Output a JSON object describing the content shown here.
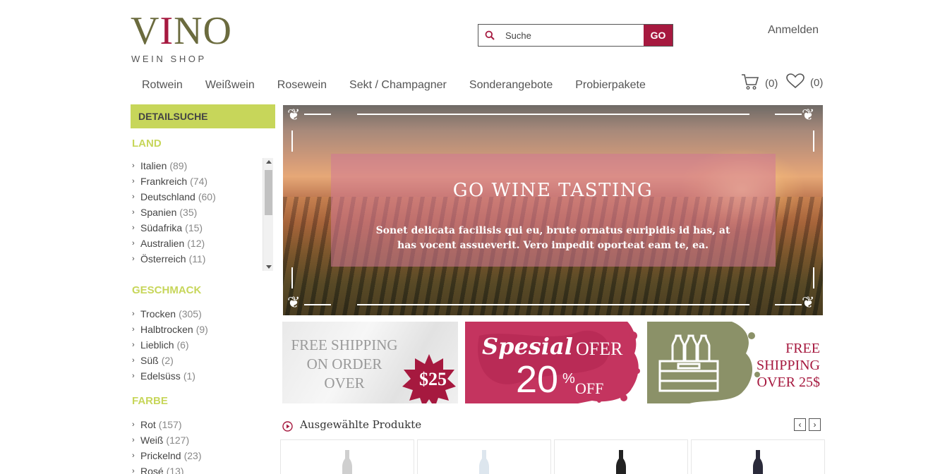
{
  "logo": {
    "main_pre": "V",
    "main_i": "I",
    "main_post": "NO",
    "sub": "WEIN SHOP"
  },
  "search": {
    "placeholder": "Suche",
    "button_label": "GO"
  },
  "header": {
    "login_label": "Anmelden",
    "cart_count": "(0)",
    "wishlist_count": "(0)"
  },
  "nav": {
    "items": [
      {
        "label": "Rotwein"
      },
      {
        "label": "Weißwein"
      },
      {
        "label": "Rosewein"
      },
      {
        "label": "Sekt / Champagner"
      },
      {
        "label": "Sonderangebote"
      },
      {
        "label": "Probierpakete"
      }
    ]
  },
  "sidebar": {
    "header": "DETAILSUCHE",
    "land": {
      "title": "LAND",
      "items": [
        {
          "label": "Italien",
          "count": "(89)"
        },
        {
          "label": "Frankreich",
          "count": "(74)"
        },
        {
          "label": "Deutschland",
          "count": "(60)"
        },
        {
          "label": "Spanien",
          "count": "(35)"
        },
        {
          "label": "Südafrika",
          "count": "(15)"
        },
        {
          "label": "Australien",
          "count": "(12)"
        },
        {
          "label": "Österreich",
          "count": "(11)"
        }
      ]
    },
    "geschmack": {
      "title": "GESCHMACK",
      "items": [
        {
          "label": "Trocken",
          "count": "(305)"
        },
        {
          "label": "Halbtrocken",
          "count": "(9)"
        },
        {
          "label": "Lieblich",
          "count": "(6)"
        },
        {
          "label": "Süß",
          "count": "(2)"
        },
        {
          "label": "Edelsüss",
          "count": "(1)"
        }
      ]
    },
    "farbe": {
      "title": "FARBE",
      "items": [
        {
          "label": "Rot",
          "count": "(157)"
        },
        {
          "label": "Weiß",
          "count": "(127)"
        },
        {
          "label": "Prickelnd",
          "count": "(23)"
        },
        {
          "label": "Rosé",
          "count": "(13)"
        }
      ]
    }
  },
  "hero": {
    "title": "GO WINE TASTING",
    "text": "Sonet delicata facilisis qui eu, brute ornatus euripidis id has, at has vocent assueverit. Vero impedit oporteat eam te, ea."
  },
  "promos": {
    "p1": {
      "line1": "FREE SHIPPING",
      "line2": "ON ORDER",
      "line3": "OVER",
      "price": "$25"
    },
    "p2": {
      "script": "Spesial",
      "ofer": "OFER",
      "percent": "20",
      "pct_sign": "%",
      "off": "OFF"
    },
    "p3": {
      "line1": "FREE",
      "line2": "SHIPPING",
      "line3": "OVER 25$"
    }
  },
  "featured": {
    "title": "Ausgewählte Produkte"
  },
  "colors": {
    "accent": "#a6193f",
    "green": "#c7d65a",
    "olive": "#6b6b3e"
  }
}
